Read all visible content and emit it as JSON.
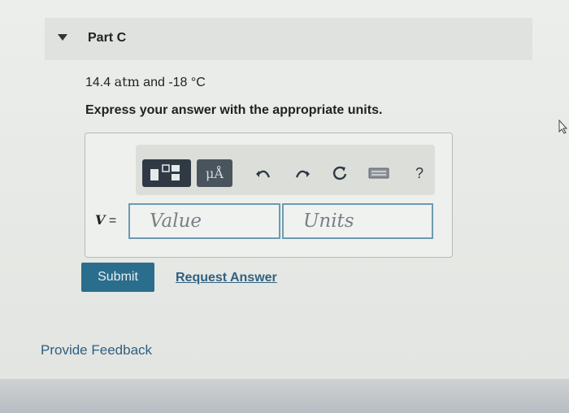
{
  "part": {
    "title": "Part C"
  },
  "question": {
    "text": "14.4 ",
    "unit": "atm",
    "rest": " and -18 °C"
  },
  "instruction": "Express your answer with the appropriate units.",
  "toolbar": {
    "mu_label": "μÅ",
    "help_label": "?"
  },
  "answer": {
    "variable": "V",
    "equals": " =",
    "value_placeholder": "Value",
    "units_placeholder": "Units"
  },
  "actions": {
    "submit_label": "Submit",
    "request_answer_label": "Request Answer"
  },
  "feedback_label": "Provide Feedback",
  "colors": {
    "submit": "#2b6d8c",
    "link": "#31617f",
    "field_border": "#6d9ab3",
    "toolbar_dark": "#2f3a44"
  }
}
